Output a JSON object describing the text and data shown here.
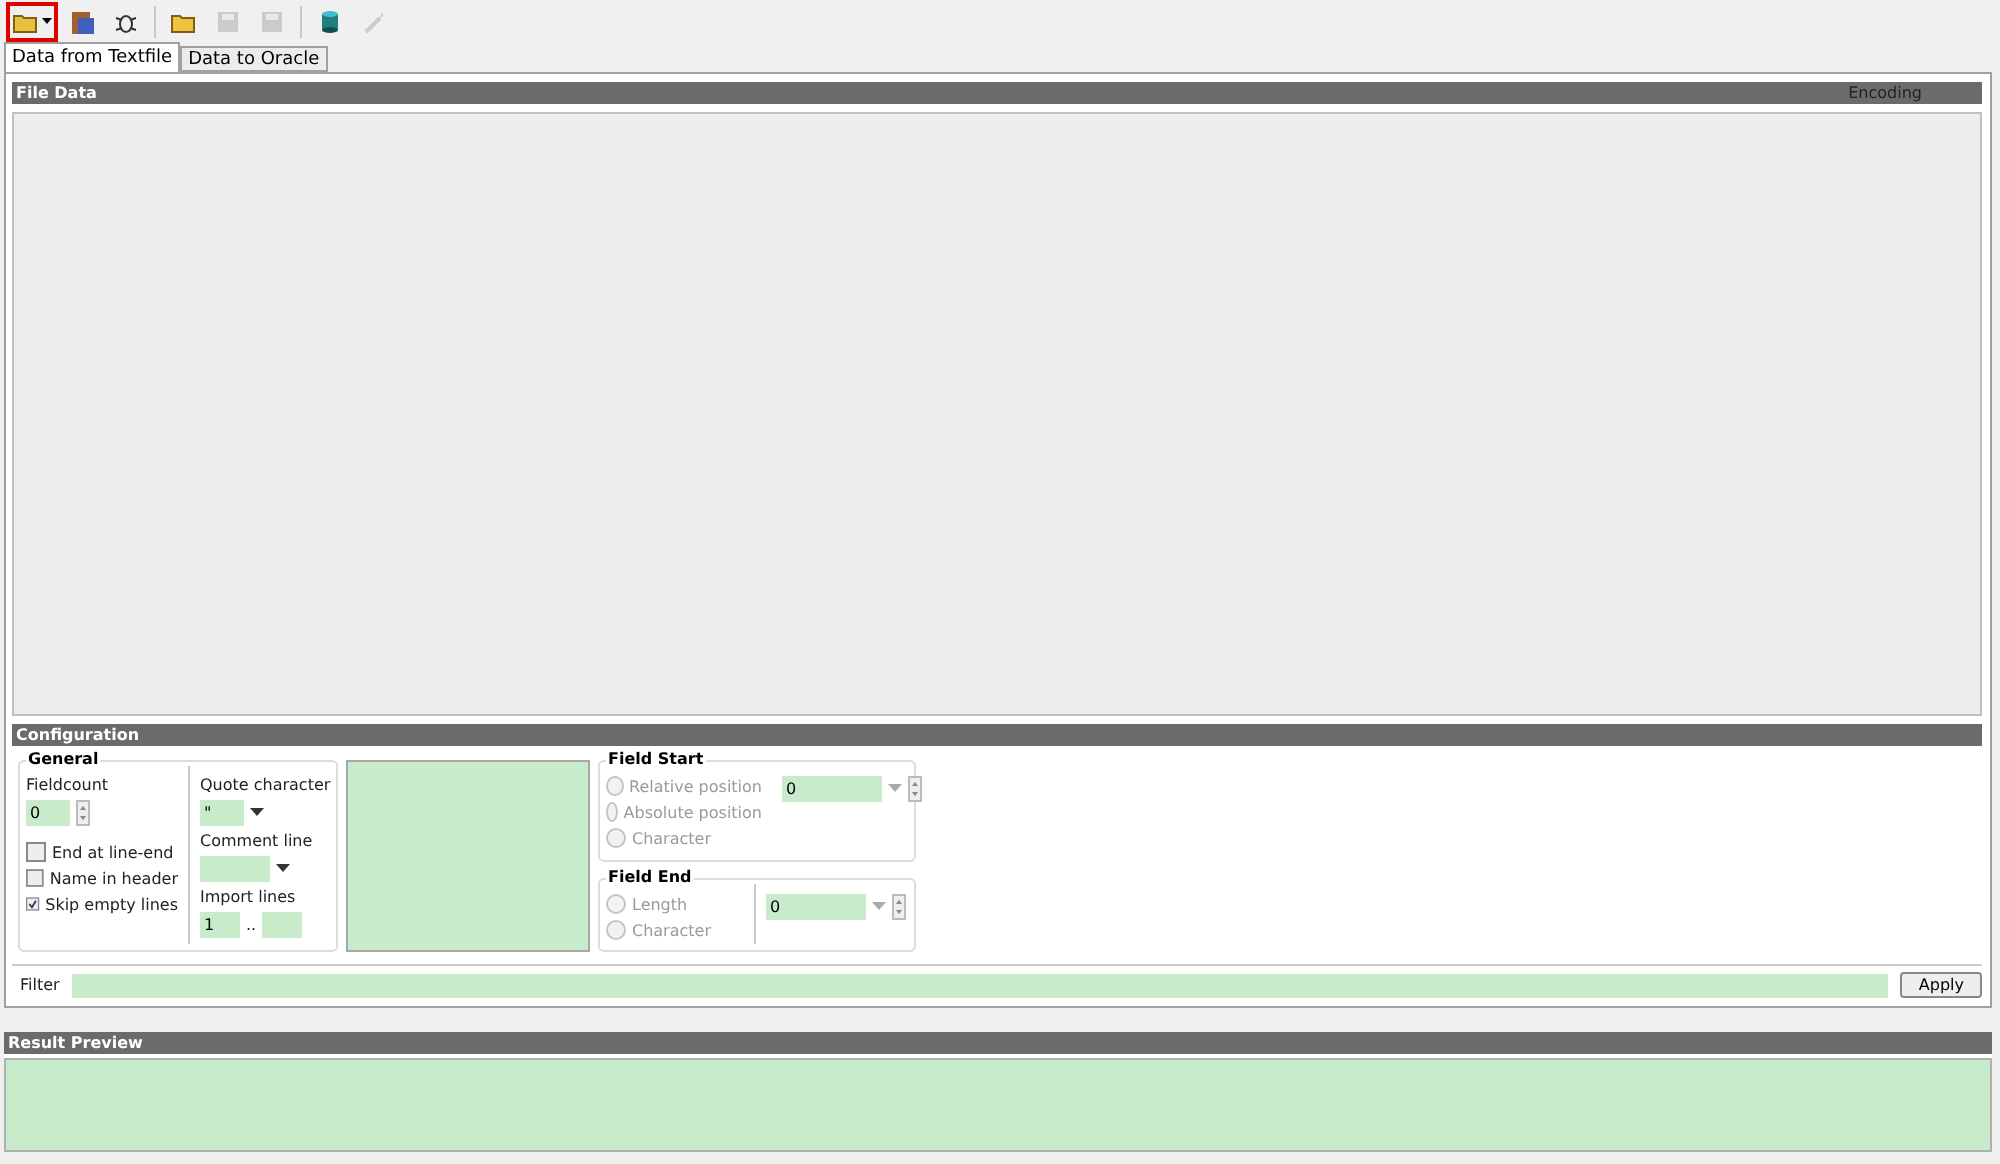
{
  "toolbar": [
    {
      "kind": "open-db",
      "disabled": false,
      "highlighted": true,
      "dropdown": true
    },
    {
      "kind": "clipboard",
      "disabled": false,
      "highlighted": false,
      "dropdown": false
    },
    {
      "kind": "bug",
      "disabled": false,
      "highlighted": false,
      "dropdown": false
    },
    {
      "kind": "folder",
      "disabled": false,
      "highlighted": false,
      "dropdown": false
    },
    {
      "kind": "save",
      "disabled": true,
      "highlighted": false,
      "dropdown": false
    },
    {
      "kind": "save",
      "disabled": true,
      "highlighted": false,
      "dropdown": false
    },
    {
      "kind": "database",
      "disabled": false,
      "highlighted": false,
      "dropdown": false
    },
    {
      "kind": "wand",
      "disabled": true,
      "highlighted": false,
      "dropdown": false
    }
  ],
  "tabs": [
    {
      "label": "Data from Textfile",
      "selected": true
    },
    {
      "label": "Data to Oracle",
      "selected": false
    }
  ],
  "file_data": {
    "title": "File Data",
    "encoding": "Encoding"
  },
  "configuration": {
    "title": "Configuration",
    "general": {
      "title": "General",
      "fieldcount_label": "Fieldcount",
      "fieldcount": "0",
      "checkboxes": [
        {
          "label": "End at line-end",
          "checked": false
        },
        {
          "label": "Name in header",
          "checked": false
        },
        {
          "label": "Skip empty lines",
          "checked": true
        }
      ],
      "quote_label": "Quote character",
      "quote": "\"",
      "comment_label": "Comment line",
      "import_label": "Import lines",
      "import_from": "1",
      "import_sep": ".."
    },
    "field_start": {
      "title": "Field Start",
      "options": [
        {
          "label": "Relative position",
          "selected": false,
          "disabled": true
        },
        {
          "label": "Absolute position",
          "selected": false,
          "disabled": true
        },
        {
          "label": "Character",
          "selected": false,
          "disabled": true
        }
      ],
      "value": "0"
    },
    "field_end": {
      "title": "Field End",
      "options": [
        {
          "label": "Length",
          "selected": false,
          "disabled": true
        },
        {
          "label": "Character",
          "selected": false,
          "disabled": true
        }
      ],
      "value": "0"
    }
  },
  "filter": {
    "label": "Filter",
    "button": "Apply"
  },
  "result_preview": {
    "title": "Result Preview"
  }
}
